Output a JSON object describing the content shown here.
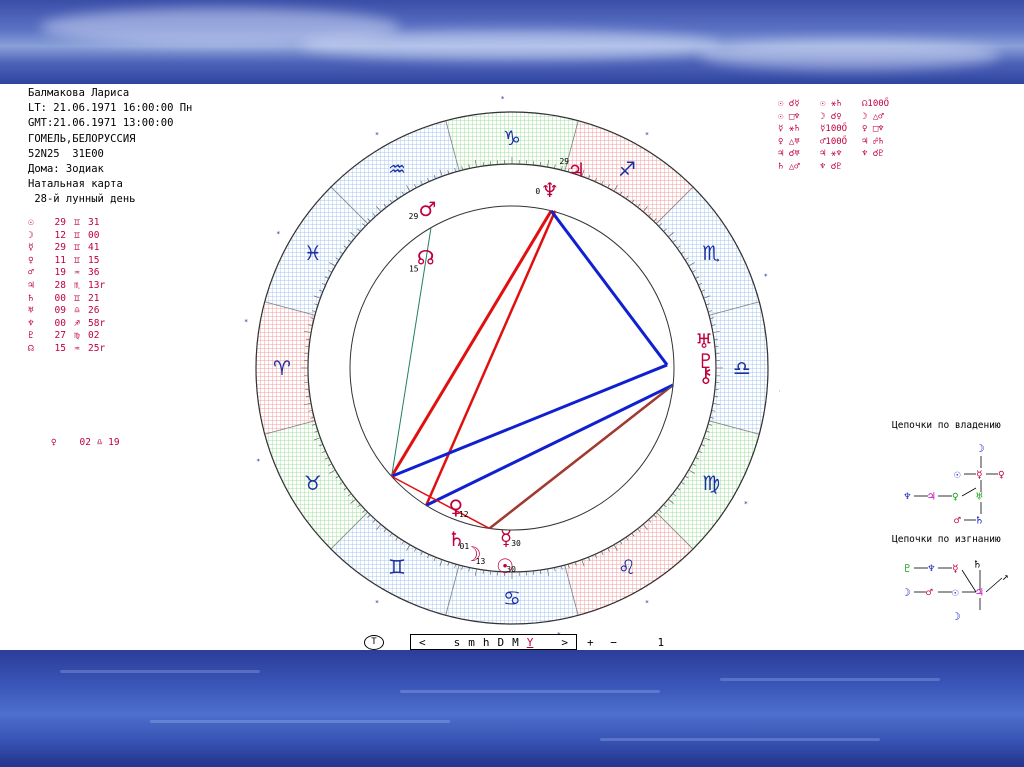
{
  "header": {
    "name": "Балмакова Лариса",
    "lt": "LT: 21.06.1971 16:00:00 Пн",
    "gmt": "GMT:21.06.1971 13:00:00",
    "place": "ГОМЕЛЬ,БЕЛОРУССИЯ",
    "coords": "52N25  31E00",
    "houses": "Дома: Зодиак",
    "chart_type": "Натальная карта",
    "lunar_day": " 28-й лунный день"
  },
  "planets": [
    {
      "glyph": "☉",
      "deg": "29",
      "sign": "♊",
      "min": "31"
    },
    {
      "glyph": "☽",
      "deg": "12",
      "sign": "♊",
      "min": "00"
    },
    {
      "glyph": "☿",
      "deg": "29",
      "sign": "♊",
      "min": "41"
    },
    {
      "glyph": "♀",
      "deg": "11",
      "sign": "♊",
      "min": "15"
    },
    {
      "glyph": "♂",
      "deg": "19",
      "sign": "♒",
      "min": "36"
    },
    {
      "glyph": "♃",
      "deg": "28",
      "sign": "♏",
      "min": "13r"
    },
    {
      "glyph": "♄",
      "deg": "00",
      "sign": "♊",
      "min": "21"
    },
    {
      "glyph": "♅",
      "deg": "09",
      "sign": "♎",
      "min": "26"
    },
    {
      "glyph": "♆",
      "deg": "00",
      "sign": "♐",
      "min": "58r"
    },
    {
      "glyph": "♇",
      "deg": "27",
      "sign": "♍",
      "min": "02"
    },
    {
      "glyph": "☊",
      "deg": "15",
      "sign": "♒",
      "min": "25r"
    }
  ],
  "extra_point": {
    "glyph": "♀",
    "deg": "02",
    "sign": "♎",
    "min": "19"
  },
  "aspects": [
    [
      "☉ ☌☿",
      "☉ ⚹♄",
      "☊100Ő"
    ],
    [
      "☉ □♆",
      "☽ ☌♀",
      "☽ △♂"
    ],
    [
      "☿ ⚹♄",
      "☿100Ő",
      "♀ □♆"
    ],
    [
      "♀ △♅",
      "♂100Ő",
      "♃ ☍♄"
    ],
    [
      "♃ ☌♅",
      "♃ ⚹♆",
      "♆ ☌♇"
    ],
    [
      "♄ △♂",
      "♆ ☌♇",
      ""
    ]
  ],
  "chains": {
    "ownership_label": "Цепочки по владению",
    "exile_label": "Цепочки по изгнанию"
  },
  "toolbar": {
    "circle": "T",
    "left": "<",
    "s": "s",
    "m": "m",
    "h": "h",
    "D": "D",
    "M": "M",
    "Y": "Y",
    "right": ">",
    "plus": "+",
    "minus": "−",
    "step": "1"
  },
  "zodiac": [
    "♈",
    "♉",
    "♊",
    "♋",
    "♌",
    "♍",
    "♎",
    "♏",
    "♐",
    "♑",
    "♒",
    "♓"
  ],
  "chart_planet_labels": {
    "mars": "29",
    "node": "15",
    "neptune": "0",
    "jupiter": "29",
    "saturn": "01",
    "moon": "13",
    "sun": "30",
    "venus": "12",
    "mercury": "30"
  },
  "colors": {
    "fire": "#f2a0a0",
    "earth": "#a0e0a0",
    "air": "#a8c8f0",
    "red": "#e01010",
    "blue": "#1020d0",
    "glyph": "#c0003c"
  }
}
